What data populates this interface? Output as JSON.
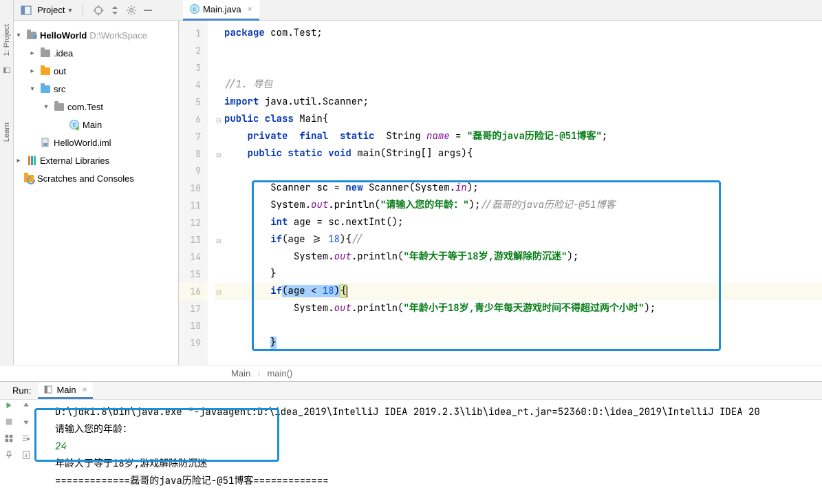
{
  "toolbar": {
    "project_label": "Project"
  },
  "tab": {
    "filename": "Main.java"
  },
  "tree": {
    "root": "HelloWorld",
    "root_path": "D:\\WorkSpace",
    "idea": ".idea",
    "out": "out",
    "src": "src",
    "pkg": "com.Test",
    "main": "Main",
    "iml": "HelloWorld.iml",
    "ext": "External Libraries",
    "scratch": "Scratches and Consoles"
  },
  "gutter": {
    "l1": "1",
    "l2": "2",
    "l3": "3",
    "l4": "4",
    "l5": "5",
    "l6": "6",
    "l7": "7",
    "l8": "8",
    "l9": "9",
    "l10": "10",
    "l11": "11",
    "l12": "12",
    "l13": "13",
    "l14": "14",
    "l15": "15",
    "l16": "16",
    "l17": "17",
    "l18": "18",
    "l19": "19"
  },
  "code": {
    "l1_kw": "package",
    "l1_rest": " com.Test;",
    "l4_cmt": "//1. 导包",
    "l5_kw": "import",
    "l5_rest": " java.util.Scanner;",
    "l6_kw1": "public",
    "l6_kw2": " class",
    "l6_rest": " Main{",
    "l7_kw": "private  final  static",
    "l7_type": "  String ",
    "l7_fld": "name",
    "l7_eq": " = ",
    "l7_str": "\"磊哥的java历险记-@51博客\"",
    "l7_semi": ";",
    "l8_kw": "public static void",
    "l8_rest": " main(String[] args){",
    "l10_a": "Scanner sc = ",
    "l10_kw": "new",
    "l10_b": " Scanner(System.",
    "l10_fld": "in",
    "l10_c": ");",
    "l11_a": "System.",
    "l11_fld": "out",
    "l11_b": ".println(",
    "l11_str": "\"请输入您的年龄：\"",
    "l11_c": ");",
    "l11_cmt": "//磊哥的java历险记-@51博客",
    "l12_kw": "int",
    "l12_rest": " age = sc.nextInt();",
    "l13_kw": "if",
    "l13_a": "(age >= ",
    "l13_num": "18",
    "l13_b": "){",
    "l13_cmt": "//",
    "l14_a": "System.",
    "l14_fld": "out",
    "l14_b": ".println(",
    "l14_str": "\"年龄大于等于18岁,游戏解除防沉迷\"",
    "l14_c": ");",
    "l15": "}",
    "l16_kw": "if",
    "l16_a": "(age < ",
    "l16_num": "18",
    "l16_b": ")",
    "l16_brace": "{",
    "l17_a": "System.",
    "l17_fld": "out",
    "l17_b": ".println(",
    "l17_str": "\"年龄小于18岁,青少年每天游戏时间不得超过两个小时\"",
    "l17_c": ");",
    "l19": "}"
  },
  "breadcrumb": {
    "main": "Main",
    "method": "main()"
  },
  "run": {
    "label": "Run:",
    "tab_name": "Main",
    "cmd": "D:\\jdk1.8\\bin\\java.exe \"-javaagent:D:\\idea_2019\\IntelliJ IDEA 2019.2.3\\lib\\idea_rt.jar=52360:D:\\idea_2019\\IntelliJ IDEA 20",
    "prompt": "请输入您的年龄：",
    "user_in": "24",
    "out1": "年龄大于等于18岁,游戏解除防沉迷",
    "out2": "=============磊哥的java历险记-@51博客============="
  },
  "side_tabs": {
    "project": "1: Project",
    "learn": "Learn"
  }
}
